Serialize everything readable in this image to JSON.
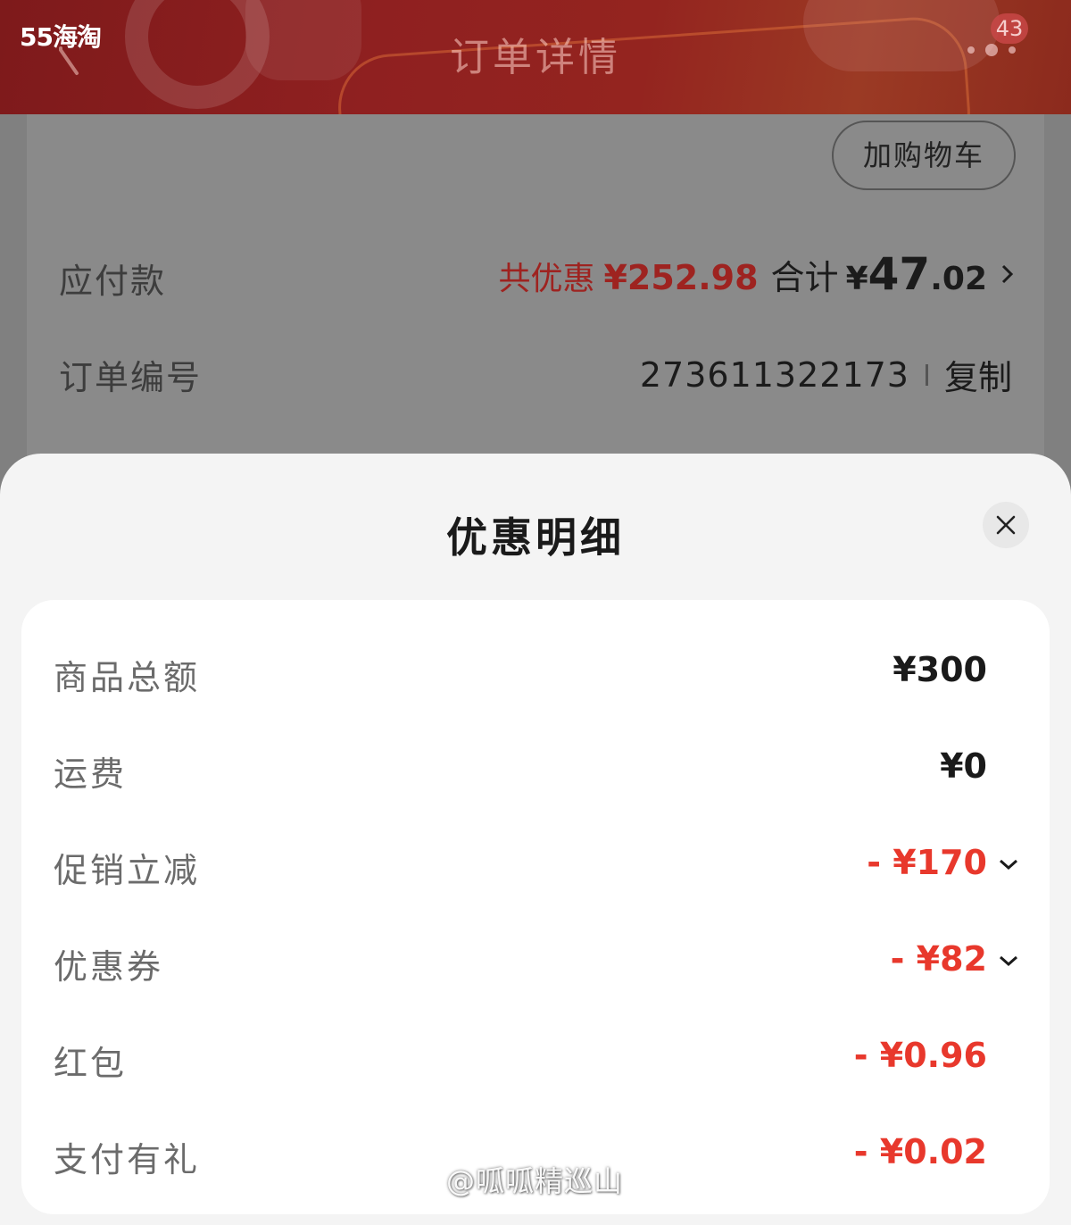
{
  "header": {
    "brand": "55海淘",
    "title": "订单详情",
    "badge_count": "43",
    "background": "#8f2020"
  },
  "order": {
    "cart_button": "加购物车",
    "payable_label": "应付款",
    "discount_label": "共优惠",
    "discount_value": "¥252.98",
    "total_label": "合计",
    "total_currency": "¥",
    "total_integer": "47",
    "total_decimal": ".02",
    "order_number_label": "订单编号",
    "order_number": "273611322173",
    "copy_label": "复制"
  },
  "sheet": {
    "title": "优惠明细",
    "rows": [
      {
        "label": "商品总额",
        "value": "¥300"
      },
      {
        "label": "运费",
        "value": "¥0"
      },
      {
        "label": "促销立减",
        "value": "- ¥170"
      },
      {
        "label": "优惠券",
        "value": "- ¥82"
      },
      {
        "label": "红包",
        "value": "- ¥0.96"
      },
      {
        "label": "支付有礼",
        "value": "- ¥0.02"
      }
    ]
  },
  "watermark": "@呱呱精巡山",
  "colors": {
    "discount_red": "#e8382c",
    "dim_red": "#9e2320"
  }
}
